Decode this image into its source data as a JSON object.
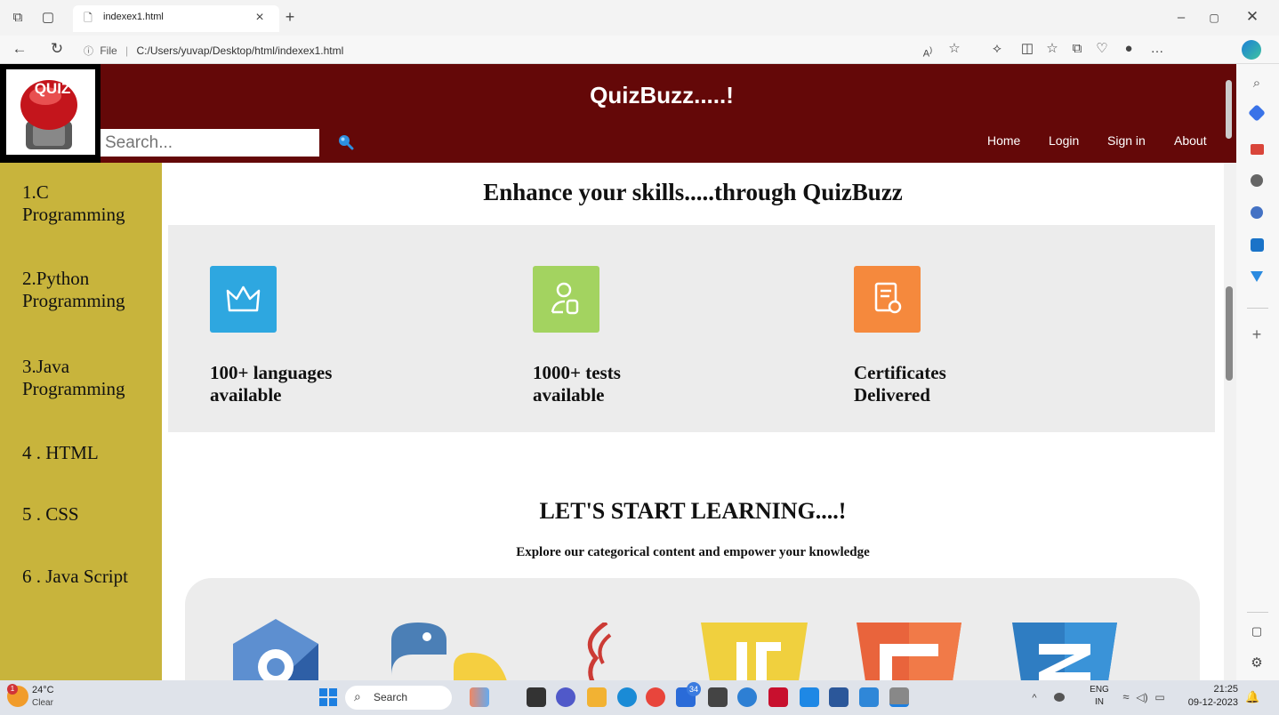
{
  "browser": {
    "tab_title": "indexex1.html",
    "url_prefix": "File",
    "url": "C:/Users/yuvap/Desktop/html/indexex1.html"
  },
  "site": {
    "logo_text": "QUIZ",
    "title": "QuizBuzz.....!",
    "search_placeholder": "Search...",
    "nav": [
      "Home",
      "Login",
      "Sign in",
      "About"
    ],
    "sidebar": [
      "1.C Programming",
      "2.Python Programming",
      "3.Java Programming",
      "4 . HTML",
      "5 . CSS",
      "6 . Java Script"
    ],
    "hero_heading": "Enhance your skills.....through QuizBuzz",
    "features": [
      {
        "line1": "100+ languages",
        "line2": "available",
        "color": "#2ea7e0",
        "icon": "crown-icon"
      },
      {
        "line1": "1000+ tests",
        "line2": "available",
        "color": "#a3d360",
        "icon": "user-badge-icon"
      },
      {
        "line1": "Certificates",
        "line2": "Delivered",
        "color": "#f5893d",
        "icon": "certificate-icon"
      }
    ],
    "learn_heading": "LET'S START LEARNING....!",
    "learn_sub": "Explore our categorical content and empower your knowledge"
  },
  "taskbar": {
    "weather_temp": "24°C",
    "weather_desc": "Clear",
    "weather_badge": "1",
    "search_label": "Search",
    "badge_count": "34",
    "lang_top": "ENG",
    "lang_bottom": "IN",
    "time": "21:25",
    "date": "09-12-2023"
  }
}
